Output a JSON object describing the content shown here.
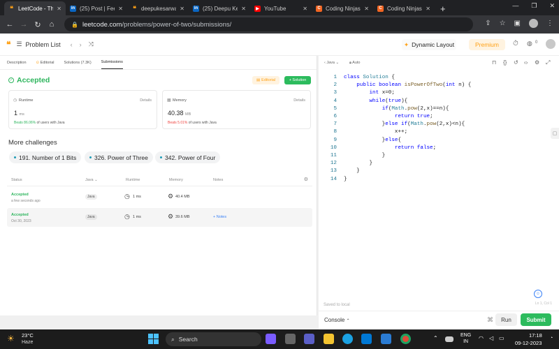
{
  "browser": {
    "tabs": [
      {
        "label": "LeetCode - Th",
        "icon": "leetcode-favicon",
        "active": true
      },
      {
        "label": "(25) Post | Fee",
        "icon": "linkedin-favicon"
      },
      {
        "label": "deepukesarwa",
        "icon": "leetcode-favicon"
      },
      {
        "label": "(25) Deepu Ke",
        "icon": "linkedin-favicon"
      },
      {
        "label": "YouTube",
        "icon": "youtube-favicon"
      },
      {
        "label": "Coding Ninjas",
        "icon": "codingninjas-favicon"
      },
      {
        "label": "Coding Ninjas",
        "icon": "codingninjas-favicon"
      }
    ],
    "url_host": "leetcode.com",
    "url_path": "/problems/power-of-two/submissions/"
  },
  "header": {
    "problem_list": "Problem List",
    "dynamic_layout": "Dynamic Layout",
    "premium": "Premium",
    "streak": "0"
  },
  "subtabs": [
    "Description",
    "Editorial",
    "Solutions (7.3K)",
    "Submissions"
  ],
  "result": {
    "status": "Accepted",
    "editorial_btn": "Editorial",
    "solution_btn": "+ Solution",
    "runtime_title": "Runtime",
    "runtime_value": "1",
    "runtime_unit": "ms",
    "runtime_beats": "Beats 86.06%",
    "runtime_beats_suffix": "of users with Java",
    "memory_title": "Memory",
    "memory_value": "40.38",
    "memory_unit": "MB",
    "memory_beats": "Beats 5.01%",
    "memory_beats_suffix": "of users with Java",
    "details": "Details"
  },
  "more": {
    "title": "More challenges",
    "items": [
      "191. Number of 1 Bits",
      "326. Power of Three",
      "342. Power of Four"
    ]
  },
  "table": {
    "headers": [
      "Status",
      "Java",
      "Runtime",
      "Memory",
      "Notes"
    ],
    "rows": [
      {
        "status": "Accepted",
        "date": "a few seconds ago",
        "lang": "Java",
        "runtime": "1 ms",
        "memory": "40.4 MB",
        "notes": ""
      },
      {
        "status": "Accepted",
        "date": "Oct 30, 2023",
        "lang": "Java",
        "runtime": "1 ms",
        "memory": "39.6 MB",
        "notes": "+ Notes"
      }
    ]
  },
  "editor": {
    "lang": "Java",
    "mode": "Auto",
    "saved": "Saved to local",
    "position": "Ln 1, Col 1",
    "console": "Console",
    "run": "Run",
    "submit": "Submit",
    "code": [
      "class Solution {",
      "    public boolean isPowerOfTwo(int n) {",
      "        int x=0;",
      "        while(true){",
      "            if(Math.pow(2,x)==n){",
      "                return true;",
      "            }else if(Math.pow(2,x)<n){",
      "                x++;",
      "            }else{",
      "                return false;",
      "            }",
      "        }",
      "    }",
      "}"
    ]
  },
  "taskbar": {
    "temp": "23°C",
    "weather": "Haze",
    "search": "Search",
    "lang": "ENG",
    "region": "IN",
    "time": "17:18",
    "date": "09-12-2023"
  },
  "colors": {
    "accent_green": "#2cbb5d",
    "accepted": "#2db55d",
    "premium": "#ffa116",
    "keyword": "#0000ff"
  }
}
